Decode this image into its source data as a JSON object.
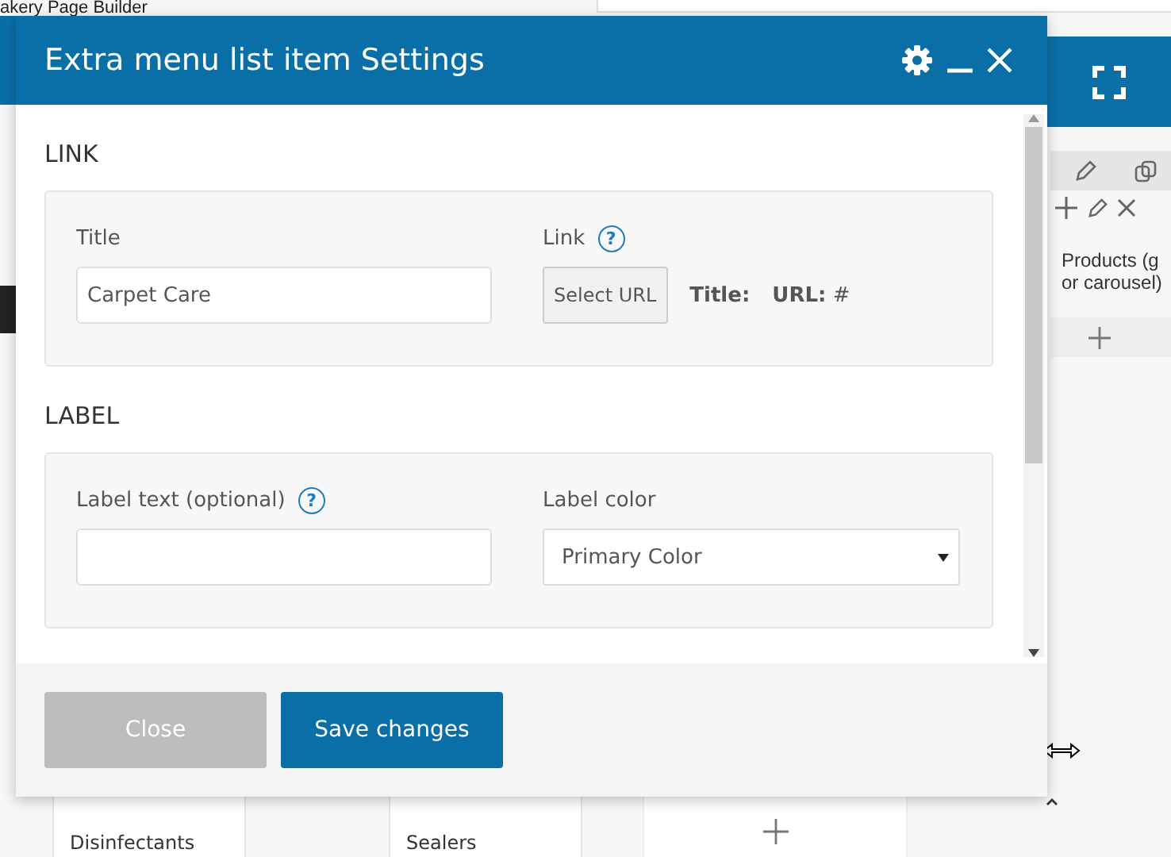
{
  "background": {
    "page_title": "akery Page Builder",
    "panel_text": "Products (g\nor carousel)",
    "columns": [
      {
        "item": "Disinfectants"
      },
      {
        "item": "Sealers"
      }
    ]
  },
  "dialog": {
    "title": "Extra menu list item Settings",
    "sections": [
      {
        "heading": "LINK",
        "fields": [
          {
            "kind": "text",
            "label": "Title",
            "value": "Carpet Care"
          },
          {
            "kind": "url",
            "label": "Link",
            "help": "?",
            "button": "Select URL",
            "title_label": "Title:",
            "url_text": "**URL:** #"
          }
        ]
      },
      {
        "heading": "LABEL",
        "fields": [
          {
            "kind": "text",
            "label": "Label text (optional)",
            "help": "?"
          },
          {
            "kind": "select",
            "label": "Label color",
            "value": "Primary Color"
          }
        ]
      }
    ],
    "buttons": [
      {
        "label": "Close",
        "kind": "secondary"
      },
      {
        "label": "Save changes",
        "kind": "primary"
      }
    ]
  }
}
